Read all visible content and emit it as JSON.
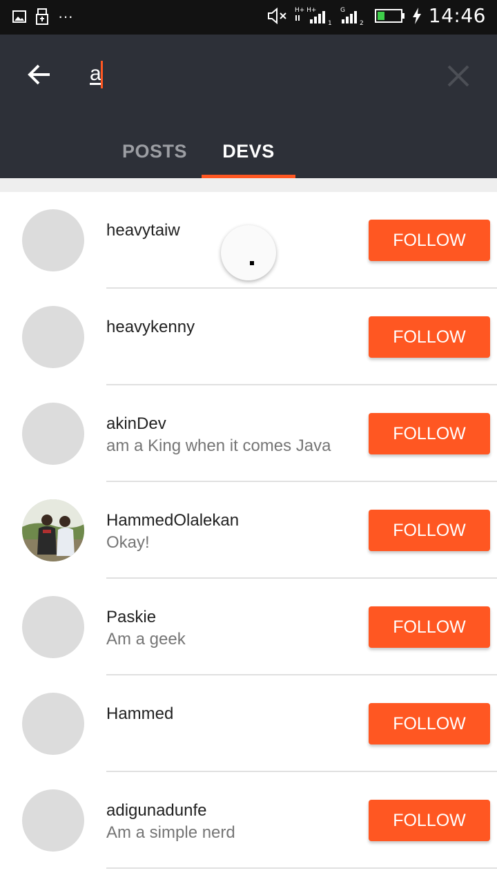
{
  "status_bar": {
    "time": "14:46",
    "icons": [
      "gallery-icon",
      "usb-icon",
      "more-dots-icon",
      "mute-icon",
      "signal-sim1-icon",
      "signal-sim2-icon",
      "battery-icon",
      "charging-icon"
    ],
    "dots": "···"
  },
  "search": {
    "query": "a"
  },
  "tabs": [
    {
      "label": "POSTS",
      "selected": false
    },
    {
      "label": "DEVS",
      "selected": true
    }
  ],
  "colors": {
    "accent": "#ff5722",
    "appbar": "#2d3038",
    "status_bar": "#121212"
  },
  "devs": [
    {
      "name": "heavytaiw",
      "bio": "",
      "has_photo": false,
      "follow_label": "FOLLOW"
    },
    {
      "name": "heavykenny",
      "bio": "",
      "has_photo": false,
      "follow_label": "FOLLOW"
    },
    {
      "name": "akinDev",
      "bio": "am a King when it comes Java",
      "has_photo": false,
      "follow_label": "FOLLOW"
    },
    {
      "name": "HammedOlalekan",
      "bio": "Okay!",
      "has_photo": true,
      "follow_label": "FOLLOW"
    },
    {
      "name": "Paskie",
      "bio": "Am a geek",
      "has_photo": false,
      "follow_label": "FOLLOW"
    },
    {
      "name": "Hammed",
      "bio": "",
      "has_photo": false,
      "follow_label": "FOLLOW"
    },
    {
      "name": "adigunadunfe",
      "bio": "Am a simple nerd",
      "has_photo": false,
      "follow_label": "FOLLOW"
    }
  ]
}
